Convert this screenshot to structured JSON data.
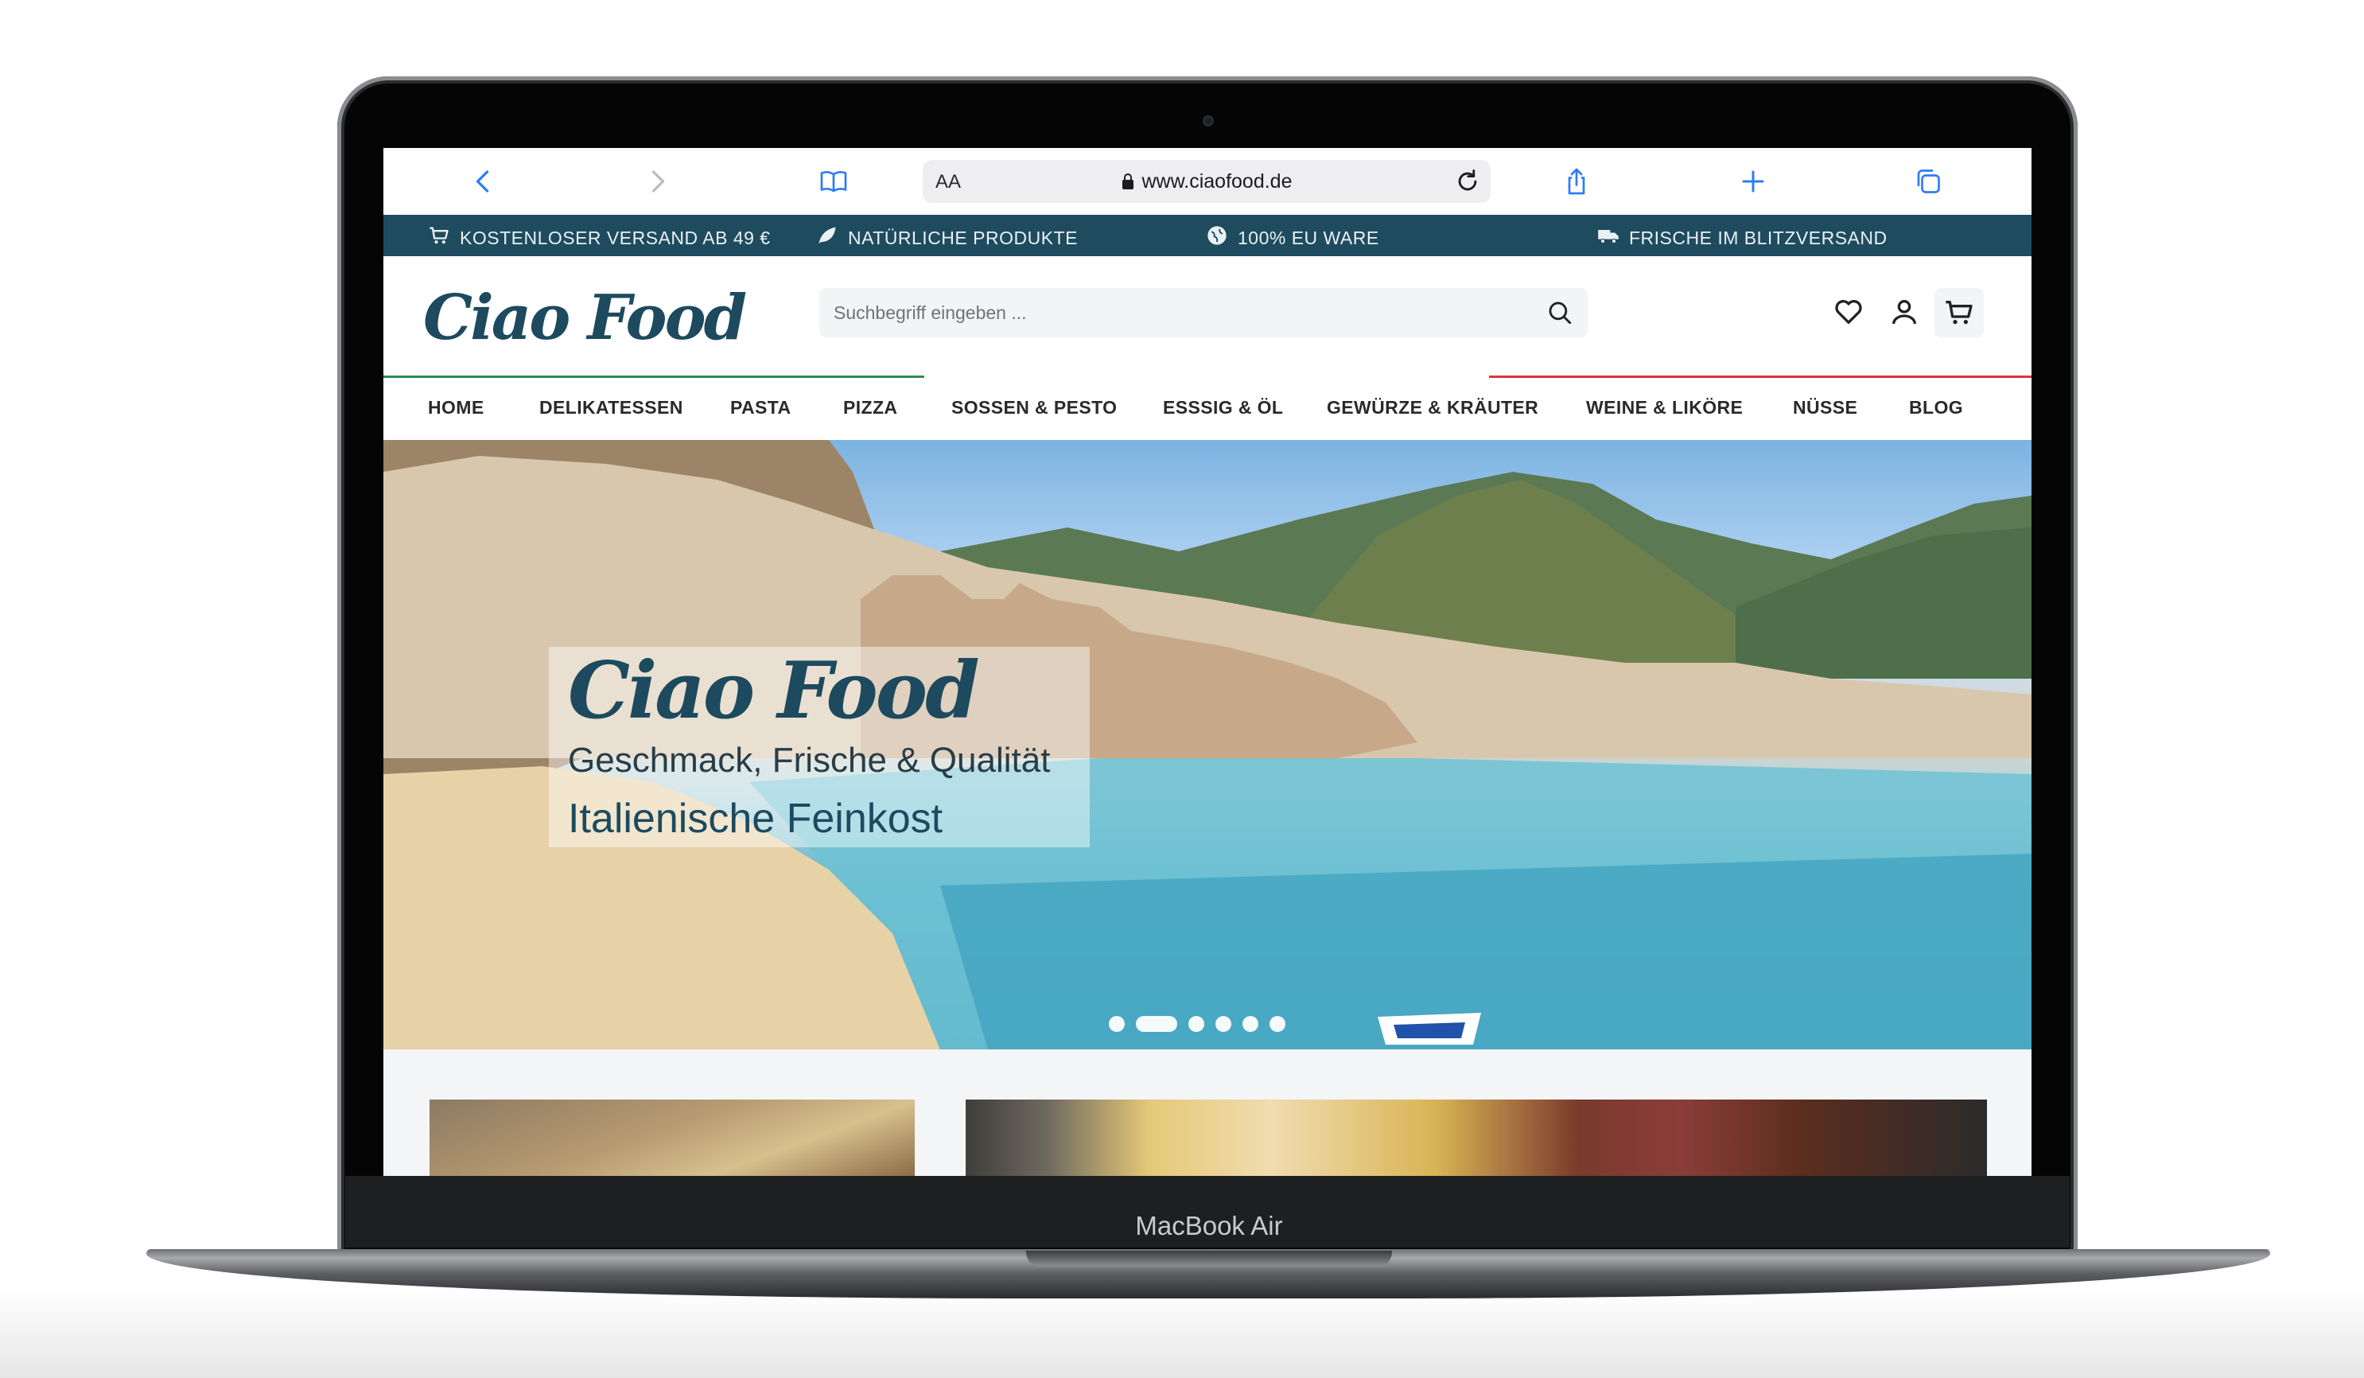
{
  "device": {
    "label": "MacBook Air"
  },
  "browser": {
    "text_size_control": "AA",
    "url": "www.ciaofood.de"
  },
  "infobar": {
    "items": [
      {
        "icon": "cart-icon",
        "label": "KOSTENLOSER VERSAND AB 49 €"
      },
      {
        "icon": "leaf-icon",
        "label": "NATÜRLICHE PRODUKTE"
      },
      {
        "icon": "globe-icon",
        "label": "100% EU WARE"
      },
      {
        "icon": "truck-icon",
        "label": "FRISCHE IM BLITZVERSAND"
      }
    ]
  },
  "header": {
    "logo": "Ciao Food",
    "search_placeholder": "Suchbegriff eingeben ..."
  },
  "nav": {
    "items": [
      "HOME",
      "DELIKATESSEN",
      "PASTA",
      "PIZZA",
      "SOSSEN & PESTO",
      "ESSSIG & ÖL",
      "GEWÜRZE & KRÄUTER",
      "WEINE & LIKÖRE",
      "NÜSSE",
      "BLOG"
    ]
  },
  "hero": {
    "title": "Ciao Food",
    "subtitle": "Geschmack, Frische & Qualität",
    "tagline": "Italienische Feinkost",
    "slides_total": 6,
    "slide_active": 2
  },
  "colors": {
    "brand": "#1d4a5e",
    "infobar": "#1f4b5f",
    "accent_green": "#2e8b57",
    "accent_red": "#d9363e",
    "browser_blue": "#2f7cf6"
  }
}
